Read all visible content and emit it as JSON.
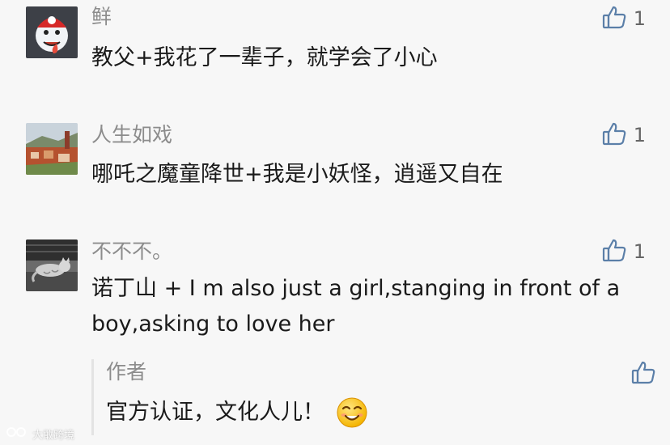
{
  "comments": [
    {
      "nickname": "鲜",
      "content": "教父+我花了一辈子，就学会了小心",
      "likes": "1",
      "avatar": "mario-ghost-avatar"
    },
    {
      "nickname": "人生如戏",
      "content": "哪吒之魔童降世+我是小妖怪，逍遥又自在",
      "likes": "1",
      "avatar": "landscape-avatar"
    },
    {
      "nickname": "不不不。",
      "content": "诺丁山 + I m also just a girl,stanging in front of a boy,asking to love her",
      "likes": "1",
      "avatar": "cat-avatar",
      "reply": {
        "author": "作者",
        "content": "官方认证，文化人儿！"
      }
    }
  ],
  "watermark": "大敢跨境",
  "colors": {
    "background": "#f7f7f7",
    "nickname": "#8c8c8c",
    "content": "#1a1a1a",
    "icon": "#5b7fa8"
  },
  "icons": {
    "like": "thumbs-up-icon",
    "emoji": "smile-emoji-icon"
  }
}
